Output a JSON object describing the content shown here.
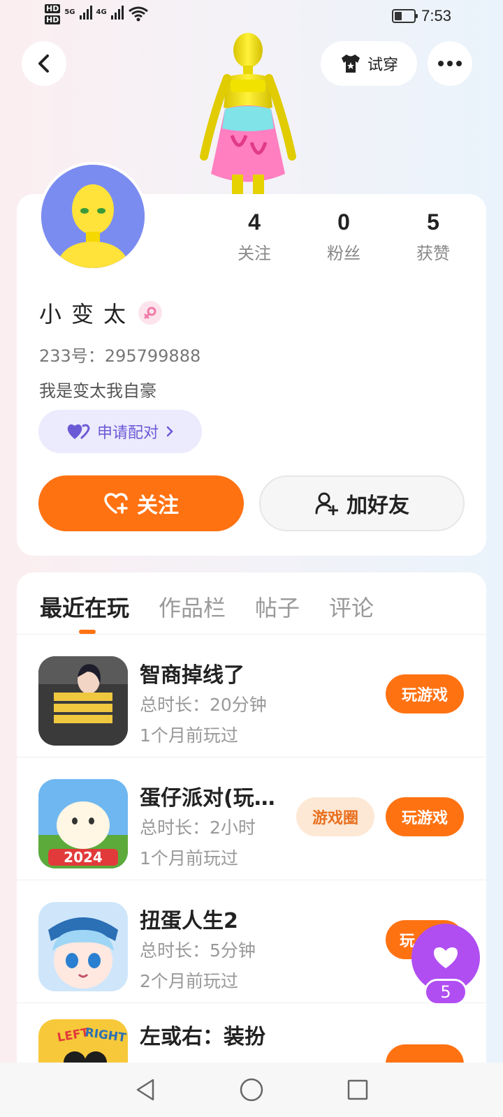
{
  "status_bar": {
    "time": "7:53",
    "net1": "5G",
    "net2": "4G",
    "hd": "HD"
  },
  "header": {
    "tryon_label": "试穿"
  },
  "profile": {
    "stats": [
      {
        "value": "4",
        "label": "关注"
      },
      {
        "value": "0",
        "label": "粉丝"
      },
      {
        "value": "5",
        "label": "获赞"
      }
    ],
    "username": "小变太",
    "uid": "233号：295799888",
    "bio": "我是变太我自豪",
    "pair_label": "申请配对",
    "follow_label": "关注",
    "add_friend_label": "加好友"
  },
  "tabs": [
    "最近在玩",
    "作品栏",
    "帖子",
    "评论"
  ],
  "games": [
    {
      "name": "智商掉线了",
      "duration": "总时长：20分钟",
      "last_played": "1个月前玩过",
      "play_label": "玩游戏",
      "circle_label": ""
    },
    {
      "name": "蛋仔派对(玩…",
      "duration": "总时长：2小时",
      "last_played": "1个月前玩过",
      "play_label": "玩游戏",
      "circle_label": "游戏圈"
    },
    {
      "name": "扭蛋人生2",
      "duration": "总时长：5分钟",
      "last_played": "2个月前玩过",
      "play_label": "玩",
      "circle_label": ""
    },
    {
      "name": "左或右：装扮",
      "duration": "",
      "last_played": "",
      "play_label": "",
      "circle_label": ""
    }
  ],
  "like_float": {
    "count": "5"
  },
  "colors": {
    "accent": "#ff7212",
    "purple": "#b04ef2",
    "pair": "#6b5ad6"
  }
}
